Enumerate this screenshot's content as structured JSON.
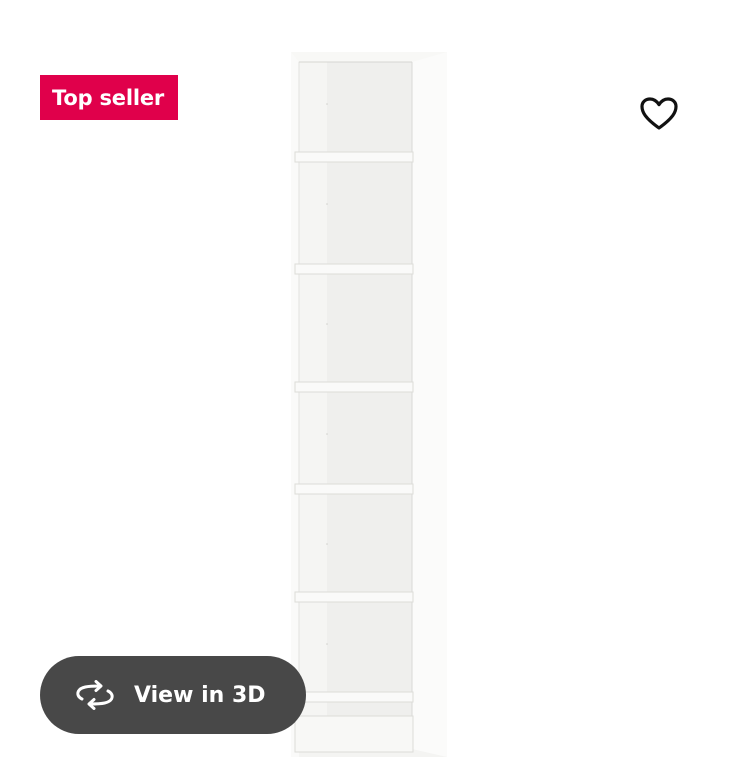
{
  "badge": {
    "label": "Top seller",
    "color": "#e0004b",
    "text_color": "#ffffff"
  },
  "favorite": {
    "icon": "heart-outline-icon",
    "color": "#111111"
  },
  "product": {
    "image_icon": "bookcase-image",
    "shelf_color": "#f6f6f4"
  },
  "view3d": {
    "label": "View in 3D",
    "icon": "rotate-arrows-icon",
    "background": "#484848",
    "text_color": "#ffffff"
  }
}
